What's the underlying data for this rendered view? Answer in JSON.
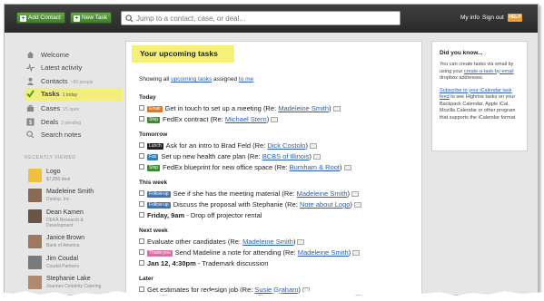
{
  "header": {
    "add_contact": "Add Contact",
    "new_task": "New Task",
    "search_placeholder": "Jump to a contact, case, or deal...",
    "my_info": "My info",
    "sign_out": "Sign out",
    "help": "HELP"
  },
  "sidebar": {
    "items": [
      {
        "label": "Welcome",
        "sub": ""
      },
      {
        "label": "Latest activity",
        "sub": ""
      },
      {
        "label": "Contacts",
        "sub": "~60 people"
      },
      {
        "label": "Tasks",
        "sub": "1 today"
      },
      {
        "label": "Cases",
        "sub": "15 open"
      },
      {
        "label": "Deals",
        "sub": "2 pending"
      },
      {
        "label": "Search notes",
        "sub": ""
      }
    ],
    "recently_viewed_label": "RECENTLY VIEWED",
    "recent": [
      {
        "name": "Logo",
        "meta": "$7,850 deal"
      },
      {
        "name": "Madeleine Smith",
        "meta": "Dunlop, Inc."
      },
      {
        "name": "Dean Kamen",
        "meta": "DEKA Research & Development"
      },
      {
        "name": "Janice Brown",
        "meta": "Bank of America"
      },
      {
        "name": "Jim Coudal",
        "meta": "Coudal Partners"
      },
      {
        "name": "Stephanie Lake",
        "meta": "Joannes Celebrity Catering"
      }
    ]
  },
  "main": {
    "title": "Your upcoming tasks",
    "showing_prefix": "Showing all",
    "showing_link": "upcoming tasks",
    "showing_mid": "assigned",
    "showing_link2": "to me",
    "groups": {
      "today": "Today",
      "tomorrow": "Tomorrow",
      "this_week": "This week",
      "next_week": "Next week",
      "later": "Later"
    },
    "tasks": [
      {
        "badge": "Email",
        "text": "Get in touch to set up a meeting",
        "re": "(Re:",
        "link": "Madeleine Smith",
        "close": ")"
      },
      {
        "badge": "Ship",
        "text": "FedEx contract",
        "re": "(Re:",
        "link": "Michael Stern",
        "close": ")"
      },
      {
        "badge": "Lunch",
        "text": "Ask for an intro to Brad Feld",
        "re": "(Re:",
        "link": "Dick Costolo",
        "close": ")"
      },
      {
        "badge": "Fax",
        "text": "Set up new health care plan",
        "re": "(Re:",
        "link": "BCBS of Illinois",
        "close": ")"
      },
      {
        "badge": "Ship",
        "text": "FedEx blueprint for new office space",
        "re": "(Re:",
        "link": "Burnham & Root",
        "close": ")"
      },
      {
        "badge": "Follow-up",
        "text": "See if she has the meeting material",
        "re": "(Re:",
        "link": "Madeleine Smith",
        "close": ")"
      },
      {
        "badge": "Follow-up",
        "text": "Discuss the proposal with Stephanie",
        "re": "(Re:",
        "link": "Note about Logo",
        "close": ")"
      },
      {
        "badge": "",
        "bold": "Friday, 9am",
        "text": "- Drop off projector rental",
        "re": "",
        "link": "",
        "close": ""
      },
      {
        "badge": "",
        "text": "Evaluate other candidates",
        "re": "(Re:",
        "link": "Madeleine Smith",
        "close": ")"
      },
      {
        "badge": "Thank-you",
        "text": "Send Madeline a note for attending",
        "re": "(Re:",
        "link": "Madeleine Smith",
        "close": ")"
      },
      {
        "badge": "",
        "bold": "Jan 12, 4:30pm",
        "text": "- Trademark discussion",
        "re": "",
        "link": "",
        "close": ""
      },
      {
        "badge": "",
        "text": "Get estimates for redesign job",
        "re": "(Re:",
        "link": "Susie Graham",
        "close": ")"
      }
    ]
  },
  "did_you_know": {
    "title": "Did you know...",
    "p1_prefix": "You can create tasks via email by using your",
    "p1_link": "create-a-task-by-email",
    "p1_suffix": "dropbox addresses.",
    "p2_link": "Subscribe to your iCalendar task feed",
    "p2_suffix": "to see Highrise tasks on your Backpack Calendar, Apple iCal, Mozilla Calendar or other program that supports the iCalendar format."
  },
  "colors": {
    "badge_email": "#e8731f",
    "badge_ship": "#3e8a2c",
    "badge_lunch": "#222222",
    "badge_fax": "#2e7fb8",
    "badge_followup": "#3a76b8",
    "badge_thankyou": "#d96fa6",
    "highlight": "#f5f178"
  }
}
